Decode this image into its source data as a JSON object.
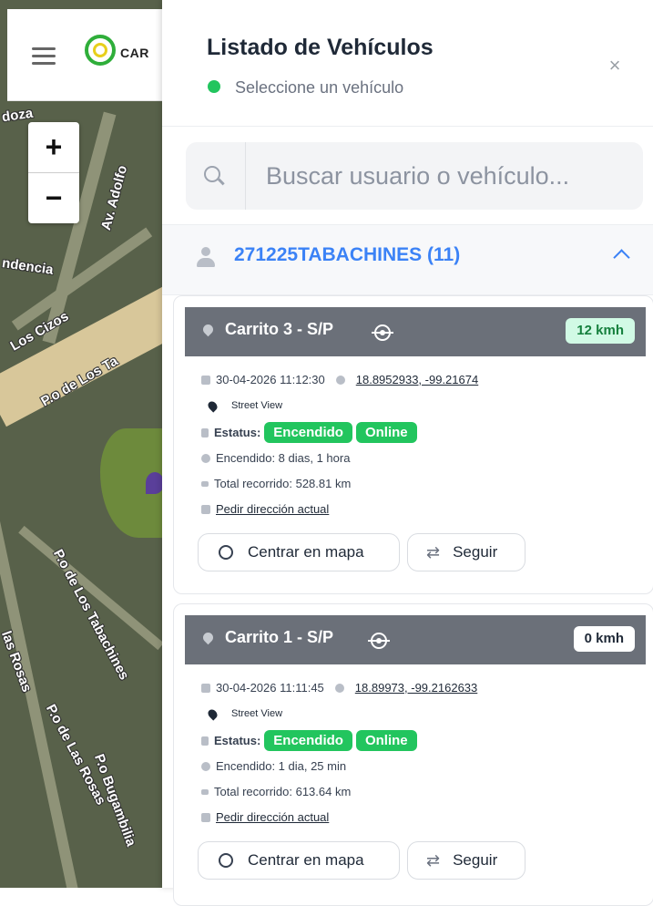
{
  "map": {
    "logo_text": "CAR",
    "zoom_in": "+",
    "zoom_out": "−",
    "labels": [
      "doza",
      "Av. Adolfo",
      "ndencia",
      "Los Cizos",
      "P.o de Los Ta",
      "P.o de Los Tabachines",
      "las Rosas",
      "P.o de Las Rosas",
      "P.o Bugambilia"
    ]
  },
  "panel": {
    "title": "Listado de Vehículos",
    "subtitle": "Seleccione un vehículo",
    "close": "×",
    "status_color": "#22c55e"
  },
  "search": {
    "placeholder": "Buscar usuario o vehículo..."
  },
  "group": {
    "label": "271225TABACHINES (11)"
  },
  "vehicles": [
    {
      "name": "Carrito 3 - S/P",
      "speed": "12 kmh",
      "datetime": "30-04-2026 11:12:30",
      "coords": "18.8952933, -99.21674",
      "street_view": "Street View",
      "status_label": "Estatus:",
      "status_on": "Encendido",
      "status_online": "Online",
      "uptime": "Encendido: 8 dias, 1 hora",
      "distance": "Total recorrido: 528.81 km",
      "request_address": "Pedir dirección actual",
      "center_button": "Centrar en mapa",
      "follow_button": "Seguir"
    },
    {
      "name": "Carrito 1 - S/P",
      "speed": "0 kmh",
      "datetime": "30-04-2026 11:11:45",
      "coords": "18.89973, -99.2162633",
      "street_view": "Street View",
      "status_label": "Estatus:",
      "status_on": "Encendido",
      "status_online": "Online",
      "uptime": "Encendido: 1 dia, 25 min",
      "distance": "Total recorrido: 613.64 km",
      "request_address": "Pedir dirección actual",
      "center_button": "Centrar en mapa",
      "follow_button": "Seguir"
    }
  ],
  "colors": {
    "accent": "#3b82f6",
    "online": "#22c55e",
    "card_header": "#6b7079",
    "speed_moving_bg": "#d1fae5",
    "speed_moving_text": "#15803d"
  }
}
